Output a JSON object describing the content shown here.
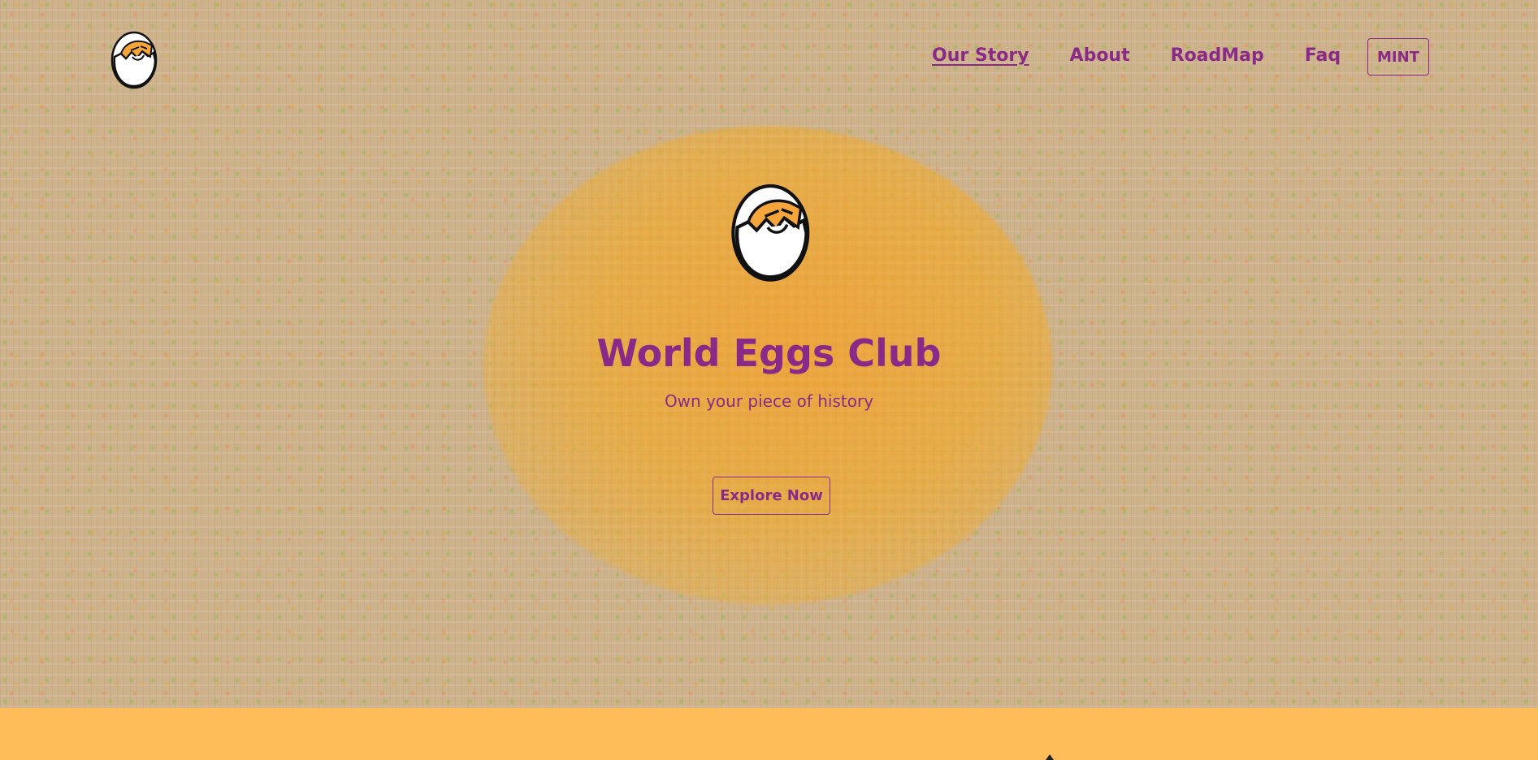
{
  "brand": {
    "logo_icon": "egg-mascot-icon"
  },
  "nav": {
    "items": [
      {
        "label": "Our Story",
        "active": true
      },
      {
        "label": "About",
        "active": false
      },
      {
        "label": "RoadMap",
        "active": false
      },
      {
        "label": "Faq",
        "active": false
      }
    ],
    "mint_label": "MINT"
  },
  "hero": {
    "mascot_icon": "egg-mascot-icon",
    "title": "World Eggs Club",
    "subtitle": "Own your piece of history",
    "cta_label": "Explore Now"
  },
  "colors": {
    "accent": "#8a2a88",
    "background": "#cdb28c",
    "glow": "#f0a030",
    "band": "#ffbd59"
  }
}
